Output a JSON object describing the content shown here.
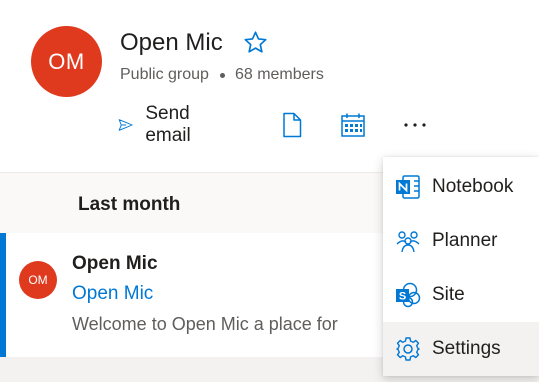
{
  "group": {
    "initials": "OM",
    "name": "Open Mic",
    "privacy": "Public group",
    "members": "68 members"
  },
  "actions": {
    "send_email": "Send email",
    "more": "···"
  },
  "feed": {
    "section_label": "Last month",
    "conversation": {
      "initials": "OM",
      "sender": "Open Mic",
      "subject": "Open Mic",
      "preview": "Welcome to Open Mic a place for"
    }
  },
  "menu": {
    "items": [
      {
        "label": "Notebook",
        "icon": "onenote-icon"
      },
      {
        "label": "Planner",
        "icon": "planner-icon"
      },
      {
        "label": "Site",
        "icon": "sharepoint-icon"
      },
      {
        "label": "Settings",
        "icon": "gear-icon"
      }
    ]
  },
  "colors": {
    "accent": "#0078d4",
    "avatar": "#e03a1e",
    "onenote": "#7719aa",
    "sharepoint": "#036c70"
  }
}
